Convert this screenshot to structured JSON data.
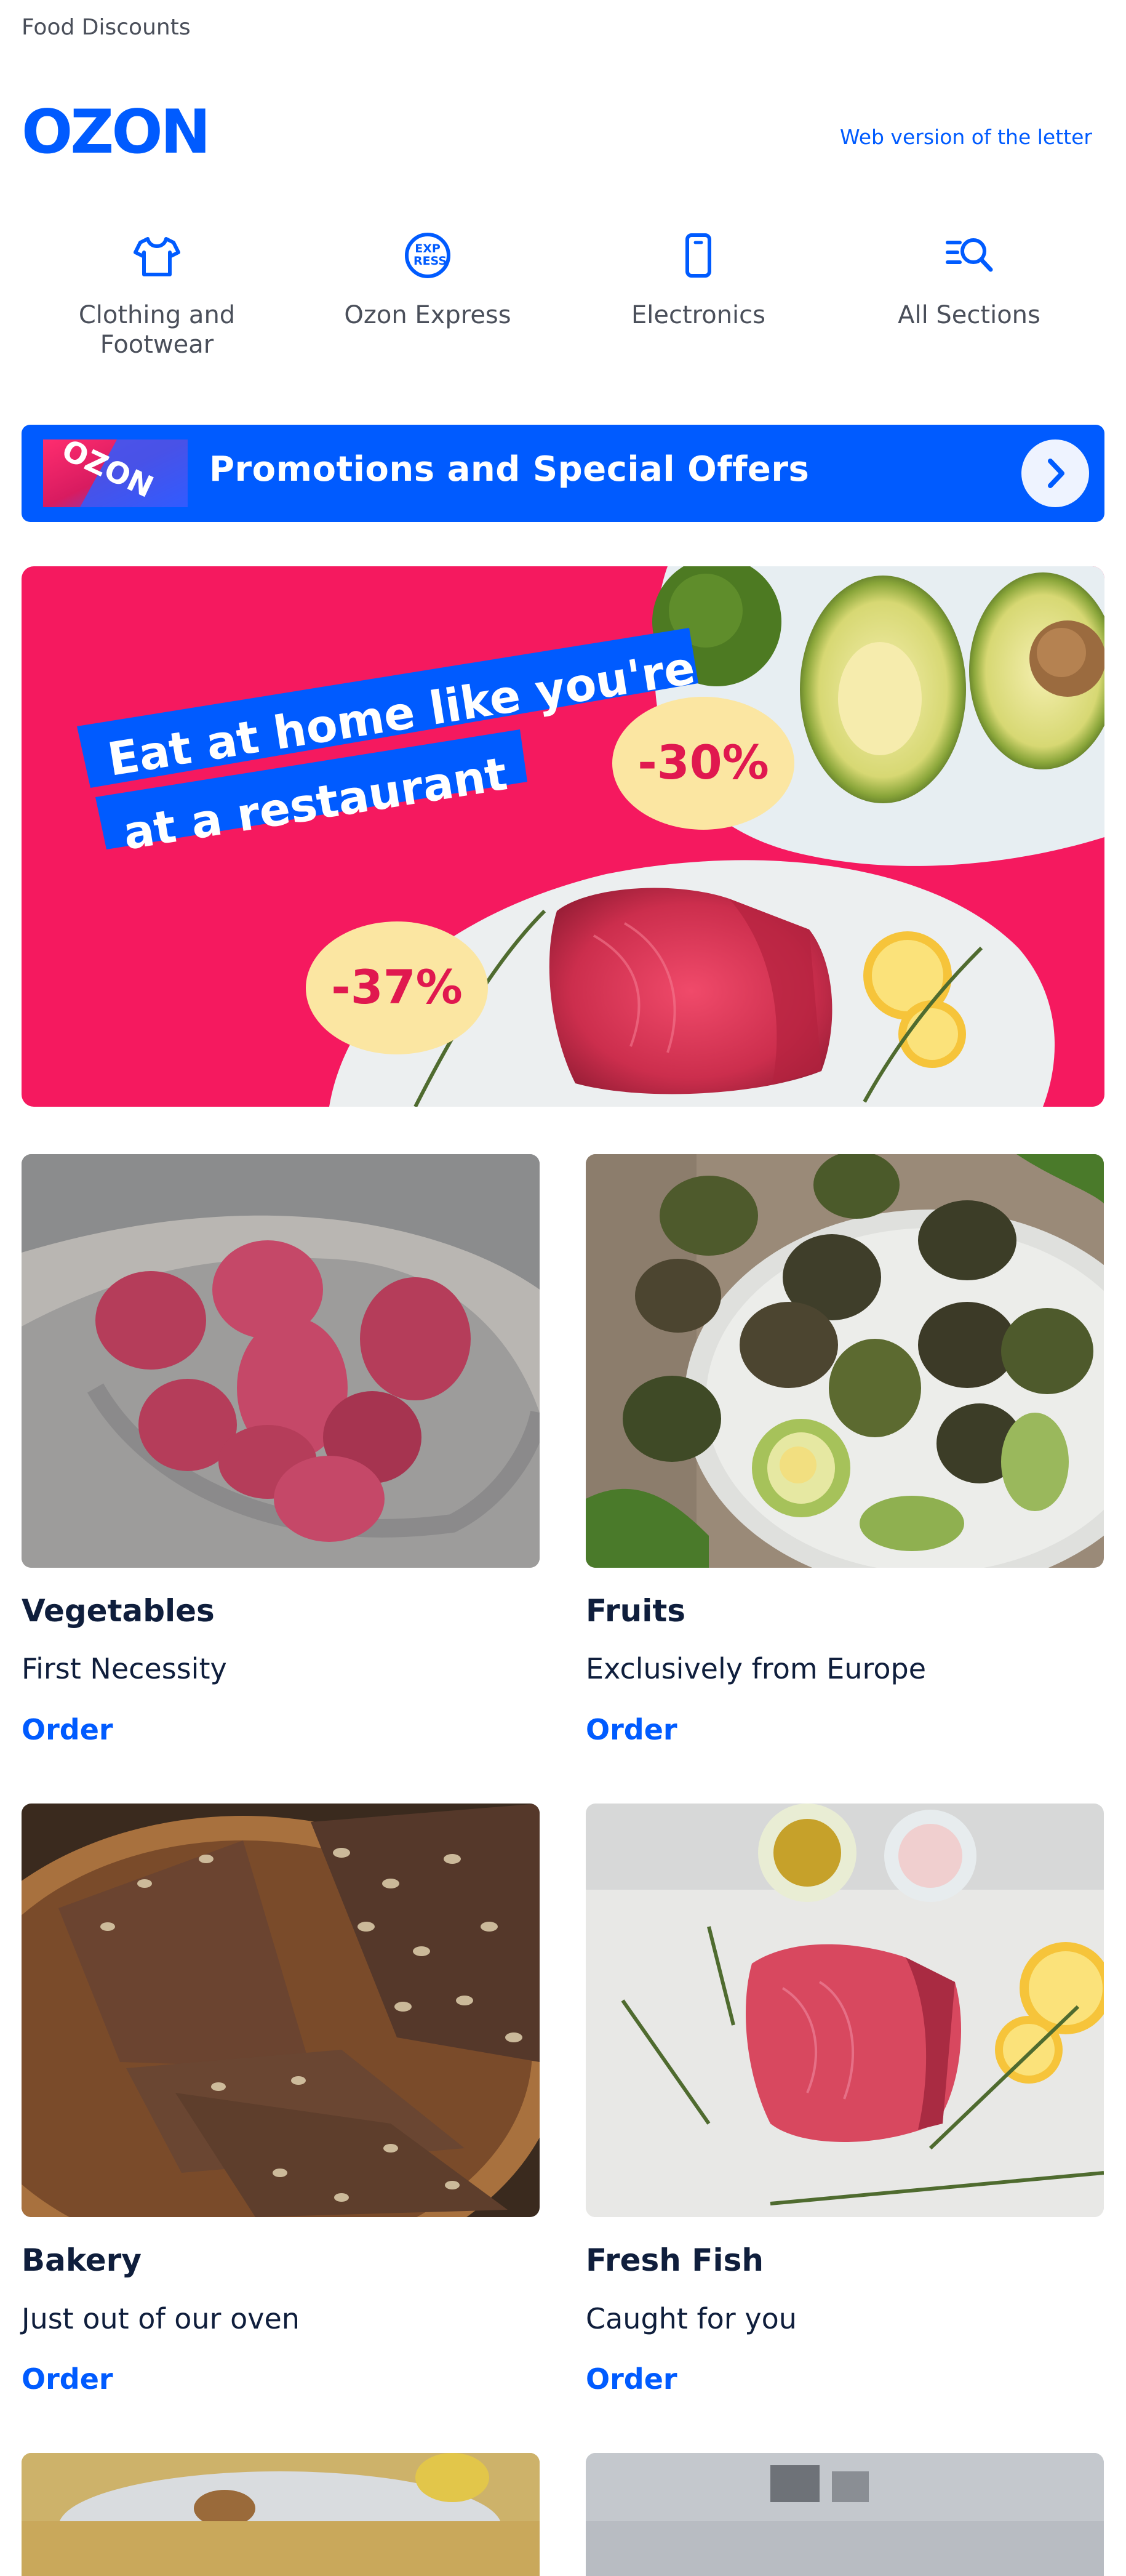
{
  "preheader": "Food Discounts",
  "header": {
    "logo_text": "OZON",
    "web_version_link": "Web version of the letter"
  },
  "categories": [
    {
      "label": "Clothing and\nFootwear",
      "icon": "tshirt-icon"
    },
    {
      "label": "Ozon Express",
      "icon": "express-icon",
      "icon_text_top": "EXP",
      "icon_text_bottom": "RESS"
    },
    {
      "label": "Electronics",
      "icon": "phone-icon"
    },
    {
      "label": "All Sections",
      "icon": "search-list-icon"
    }
  ],
  "promo": {
    "label": "Promotions and Special Offers",
    "badge_text": "OZON",
    "icon": "chevron-right-icon"
  },
  "hero": {
    "headline_line1": "Eat at home like you're",
    "headline_line2": "at a restaurant",
    "discount_1": "-30%",
    "discount_2": "-37%"
  },
  "products": [
    {
      "title": "Vegetables",
      "subtitle": "First Necessity",
      "cta": "Order"
    },
    {
      "title": "Fruits",
      "subtitle": "Exclusively from Europe",
      "cta": "Order"
    },
    {
      "title": "Bakery",
      "subtitle": "Just out of our oven",
      "cta": "Order"
    },
    {
      "title": "Fresh Fish",
      "subtitle": "Caught for you",
      "cta": "Order"
    }
  ],
  "colors": {
    "brand_blue": "#005bff",
    "hero_pink": "#f5195f",
    "discount_bg": "#fbe6a2",
    "text_dark": "#0f1e3c"
  }
}
